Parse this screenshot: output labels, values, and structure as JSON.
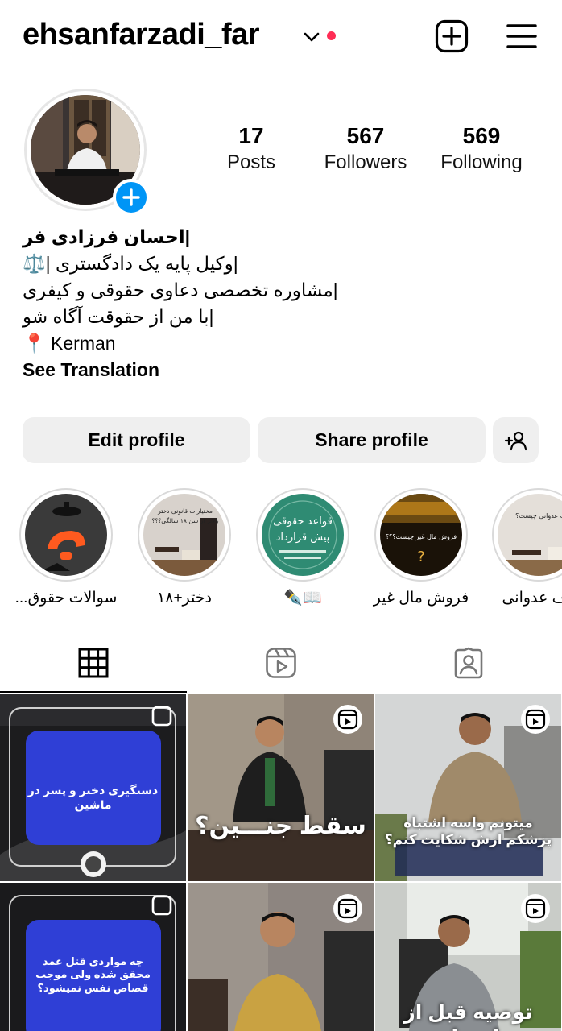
{
  "header": {
    "username": "ehsanfarzadi_far",
    "chevron_icon": "chevron-down-icon",
    "create_icon": "plus-square-icon",
    "menu_icon": "hamburger-menu-icon",
    "accent_dot_color": "#ff2d55"
  },
  "profile": {
    "avatar_icon": "profile-photo",
    "add_story_icon": "plus-icon",
    "stats": {
      "posts": {
        "count": "17",
        "label": "Posts"
      },
      "followers": {
        "count": "567",
        "label": "Followers"
      },
      "following": {
        "count": "569",
        "label": "Following"
      }
    },
    "bio": {
      "name": "|احسان فرزادی فر",
      "line1": "|وکیل پایه یک دادگستری |⚖️",
      "line2": "|مشاوره تخصصی دعاوی حقوقی و کیفری",
      "line3": "|با من از حقوقت آگاه شو",
      "location": "📍 Kerman",
      "see_translation": "See Translation"
    }
  },
  "actions": {
    "edit_profile": "Edit profile",
    "share_profile": "Share profile",
    "discover_icon": "add-person-icon"
  },
  "highlights": [
    {
      "label": "سوالات حقوق..."
    },
    {
      "label": "دختر+۱۸"
    },
    {
      "label": "📖✒️"
    },
    {
      "label": "فروش مال غیر"
    },
    {
      "label": "رف عدوانی"
    }
  ],
  "highlight_texts": {
    "h2": "مختیارات قانونی دختر\nبالاتر از سن ۱۸ سالگی؟؟؟",
    "h3": "قواعد حقوقی\nپیش قرارداد",
    "h4": "فروش مال غیر چیست؟؟؟",
    "h5": "رف عدوانی چیست؟"
  },
  "tabs": {
    "grid_icon": "grid-icon",
    "reels_icon": "reels-icon",
    "tagged_icon": "tagged-person-icon",
    "active_color": "#000000"
  },
  "posts": [
    {
      "caption": "دستگیری دختر و پسر در ماشین",
      "type": "carousel"
    },
    {
      "caption": "سقط جنـــین؟",
      "type": "reel"
    },
    {
      "caption": "میتونم واسه اشتباه پزشکم ازش شکایت کنم؟",
      "type": "reel"
    },
    {
      "caption": "چه مواردی قتل عمد محقق شده ولی موجب قصاص نفس نمیشود؟",
      "type": "carousel"
    },
    {
      "caption": "",
      "type": "reel"
    },
    {
      "caption": "توصیه قبل از ازدواج",
      "type": "reel"
    }
  ]
}
